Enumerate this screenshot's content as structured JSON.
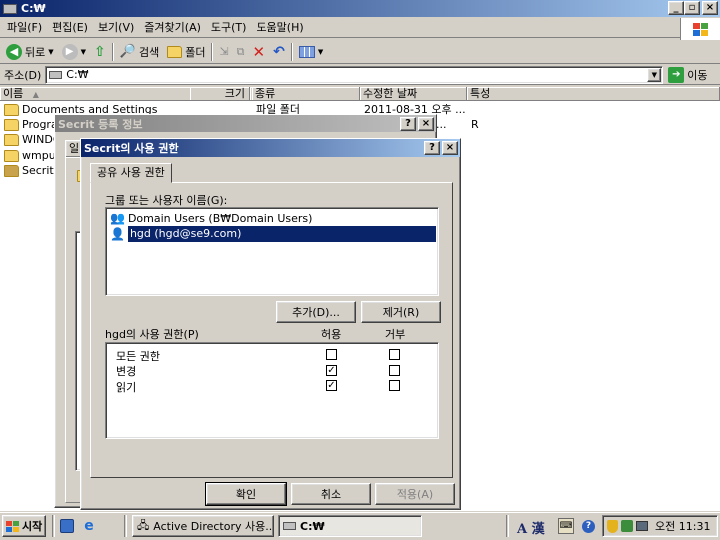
{
  "window": {
    "title": "C:₩"
  },
  "menu": [
    "파일(F)",
    "편집(E)",
    "보기(V)",
    "즐겨찾기(A)",
    "도구(T)",
    "도움말(H)"
  ],
  "toolbar": {
    "back": "뒤로",
    "search": "검색",
    "folders": "폴더"
  },
  "address": {
    "label": "주소(D)",
    "value": "C:₩",
    "go": "이동"
  },
  "list": {
    "columns": [
      "이름",
      "크기",
      "종류",
      "수정한 날짜",
      "특성"
    ],
    "row0": {
      "name": "Documents and Settings",
      "type": "파일 폴더",
      "date": "2011-08-31 오후 ..."
    },
    "row1": {
      "name": "Progra",
      "date": "...",
      "attr": "R"
    },
    "row2": {
      "name": "WINDO"
    },
    "row3": {
      "name": "wmpu"
    },
    "row4": {
      "name": "Secrit"
    }
  },
  "props_dialog": {
    "title": "Secrit 등록 정보",
    "tab_fragment": "일"
  },
  "dialog": {
    "title": "Secrit의 사용 권한",
    "tab": "공유 사용 권한",
    "group_label": "그룹 또는 사용자 이름(G):",
    "users": [
      "Domain Users (B₩Domain Users)",
      "hgd (hgd@se9.com)"
    ],
    "add_button": "추가(D)...",
    "remove_button": "제거(R)",
    "perm_label": "hgd의 사용 권한(P)",
    "allow_header": "허용",
    "deny_header": "거부",
    "permissions": [
      {
        "name": "모든 권한",
        "allow": false,
        "deny": false
      },
      {
        "name": "변경",
        "allow": true,
        "deny": false
      },
      {
        "name": "읽기",
        "allow": true,
        "deny": false
      }
    ],
    "ok": "확인",
    "cancel": "취소",
    "apply": "적용(A)"
  },
  "taskbar": {
    "start": "시작",
    "tasks": [
      "Active Directory 사용...",
      "C:₩"
    ],
    "ime": "A 漢",
    "clock": "오전 11:31"
  },
  "colors": {
    "title_active": "#0a246a",
    "selection": "#0a246a",
    "face": "#d4d0c8",
    "taskbar": "#d4d0c8"
  }
}
